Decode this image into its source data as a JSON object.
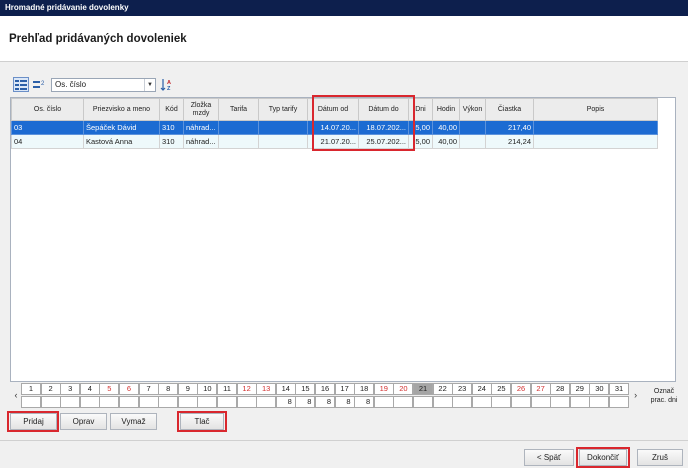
{
  "window": {
    "title": "Hromadné pridávanie dovolenky"
  },
  "header": {
    "title": "Prehľad pridávaných dovoleniek"
  },
  "toolbar": {
    "sort_field": "Os. číslo"
  },
  "grid": {
    "columns": [
      "Os. číslo",
      "Priezvisko a meno",
      "Kód",
      "Zložka mzdy",
      "Tarifa",
      "Typ tarify",
      "Dátum od",
      "Dátum do",
      "Dni",
      "Hodin",
      "Výkon",
      "Čiastka",
      "Popis"
    ],
    "rows": [
      [
        "03",
        "Šepáček Dávid",
        "310",
        "náhrad...",
        "",
        "",
        "14.07.20...",
        "18.07.202...",
        "5,00",
        "40,00",
        "",
        "217,40",
        ""
      ],
      [
        "04",
        "Kastová Anna",
        "310",
        "náhrad...",
        "",
        "",
        "21.07.20...",
        "25.07.202...",
        "5,00",
        "40,00",
        "",
        "214,24",
        ""
      ]
    ]
  },
  "calendar": {
    "days": [
      "1",
      "2",
      "3",
      "4",
      "5",
      "6",
      "7",
      "8",
      "9",
      "10",
      "11",
      "12",
      "13",
      "14",
      "15",
      "16",
      "17",
      "18",
      "19",
      "20",
      "21",
      "22",
      "23",
      "24",
      "25",
      "26",
      "27",
      "28",
      "29",
      "30",
      "31"
    ],
    "weekends": [
      "5",
      "6",
      "12",
      "13",
      "19",
      "20",
      "26",
      "27"
    ],
    "today": "21",
    "values": [
      "",
      "",
      "",
      "",
      "",
      "",
      "",
      "",
      "",
      "",
      "",
      "",
      "",
      "8",
      "8",
      "8",
      "8",
      "8",
      "",
      "",
      "",
      "",
      "",
      "",
      "",
      "",
      "",
      "",
      "",
      "",
      ""
    ],
    "arrow_left": "‹",
    "arrow_right": "›",
    "mark_days_label_1": "Označ",
    "mark_days_label_2": "prac. dni"
  },
  "actions": {
    "add": "Pridaj",
    "edit": "Oprav",
    "delete": "Vymaž",
    "print": "Tlač"
  },
  "footer": {
    "back": "< Späť",
    "finish": "Dokončiť",
    "cancel": "Zruš"
  },
  "colors": {
    "selection": "#1c6bd2",
    "highlight_frame": "#d9272e",
    "titlebar": "#0d1f4d",
    "weekend_text": "#d3302f"
  }
}
